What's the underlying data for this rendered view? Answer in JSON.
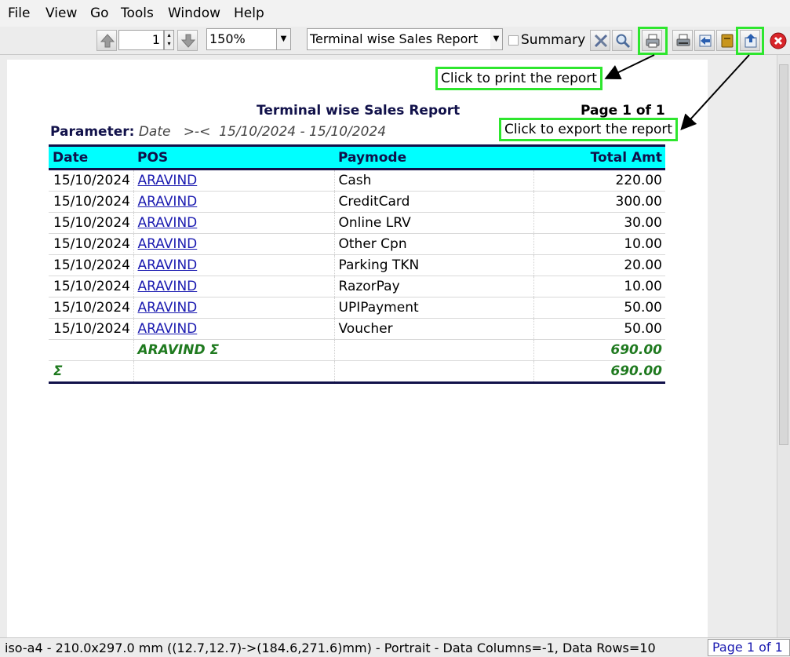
{
  "menu": [
    "File",
    "View",
    "Go",
    "Tools",
    "Window",
    "Help"
  ],
  "toolbar": {
    "page_number": "1",
    "zoom": "150%",
    "report_name": "Terminal wise Sales Report",
    "summary_label": "Summary"
  },
  "report": {
    "title": "Terminal wise Sales Report",
    "page_label": "Page 1 of 1",
    "parameter_label": "Parameter:",
    "parameter_field": "Date",
    "parameter_op": ">-<",
    "parameter_value": "15/10/2024 - 15/10/2024",
    "columns": [
      "Date",
      "POS",
      "Paymode",
      "Total Amt"
    ],
    "rows": [
      [
        "15/10/2024",
        "ARAVIND",
        "Cash",
        "220.00"
      ],
      [
        "15/10/2024",
        "ARAVIND",
        "CreditCard",
        "300.00"
      ],
      [
        "15/10/2024",
        "ARAVIND",
        "Online LRV",
        "30.00"
      ],
      [
        "15/10/2024",
        "ARAVIND",
        "Other Cpn",
        "10.00"
      ],
      [
        "15/10/2024",
        "ARAVIND",
        "Parking TKN",
        "20.00"
      ],
      [
        "15/10/2024",
        "ARAVIND",
        "RazorPay",
        "10.00"
      ],
      [
        "15/10/2024",
        "ARAVIND",
        "UPIPayment",
        "50.00"
      ],
      [
        "15/10/2024",
        "ARAVIND",
        "Voucher",
        "50.00"
      ]
    ],
    "subtotal_label": "ARAVIND Σ",
    "subtotal_value": "690.00",
    "total_label": "Σ",
    "total_value": "690.00"
  },
  "callouts": {
    "print": "Click to print the report",
    "export": "Click to export the report"
  },
  "status": {
    "text": "iso-a4 - 210.0x297.0 mm ((12.7,12.7)->(184.6,271.6)mm) - Portrait - Data Columns=-1, Data Rows=10",
    "page": "Page 1 of 1"
  },
  "colors": {
    "header_bg": "#00ffff",
    "header_text": "#11114a",
    "subtotal_text": "#1f7a1f",
    "highlight": "#2ee62e",
    "link": "#1a1ab0"
  },
  "icons": [
    "up-arrow-icon",
    "down-arrow-icon",
    "tools-icon",
    "search-icon",
    "print-icon",
    "print-setup-icon",
    "back-icon",
    "book-icon",
    "export-icon",
    "close-icon"
  ]
}
